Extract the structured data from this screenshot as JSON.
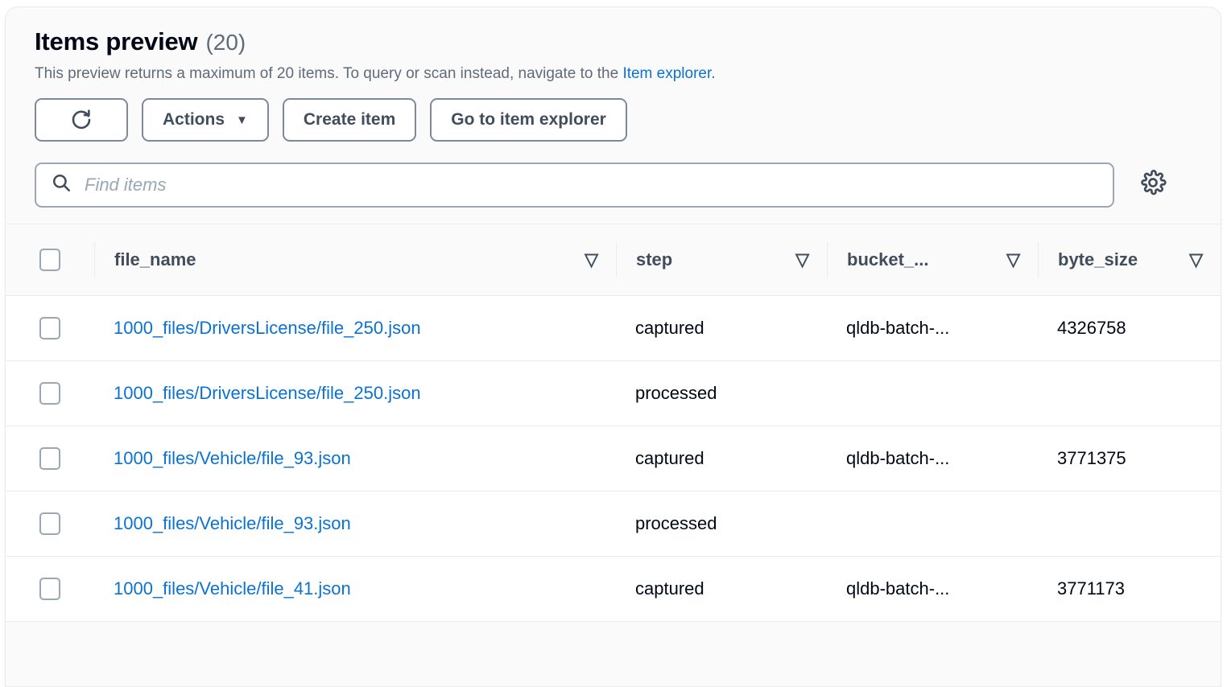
{
  "panel": {
    "title": "Items preview",
    "count": "(20)",
    "subtitle_before": "This preview returns a maximum of 20 items. To query or scan instead, navigate to the ",
    "subtitle_link": "Item explorer.",
    "icons": {
      "refresh": "refresh-icon",
      "settings": "gear-icon",
      "search": "search-icon",
      "sort": "sort-descending-icon"
    },
    "colors": {
      "link": "#0972d3",
      "text": "#000716",
      "muted": "#5f6b7a",
      "border": "#e9ebed",
      "button_border": "#7d8998",
      "background": "#fafafa",
      "row_background": "#ffffff"
    }
  },
  "toolbar": {
    "refresh_label": "",
    "actions_label": "Actions",
    "actions_caret": "▼",
    "create_item_label": "Create item",
    "go_to_item_explorer_label": "Go to item explorer"
  },
  "search": {
    "placeholder": "Find items",
    "value": ""
  },
  "table": {
    "columns": [
      {
        "key": "file_name",
        "label": "file_name"
      },
      {
        "key": "step",
        "label": "step"
      },
      {
        "key": "bucket",
        "label": "bucket_..."
      },
      {
        "key": "byte_size",
        "label": "byte_size"
      }
    ],
    "sort_glyph": "▽",
    "rows": [
      {
        "file_name": "1000_files/DriversLicense/file_250.json",
        "step": "captured",
        "bucket": "qldb-batch-...",
        "byte_size": "4326758"
      },
      {
        "file_name": "1000_files/DriversLicense/file_250.json",
        "step": "processed",
        "bucket": "",
        "byte_size": ""
      },
      {
        "file_name": "1000_files/Vehicle/file_93.json",
        "step": "captured",
        "bucket": "qldb-batch-...",
        "byte_size": "3771375"
      },
      {
        "file_name": "1000_files/Vehicle/file_93.json",
        "step": "processed",
        "bucket": "",
        "byte_size": ""
      },
      {
        "file_name": "1000_files/Vehicle/file_41.json",
        "step": "captured",
        "bucket": "qldb-batch-...",
        "byte_size": "3771173"
      }
    ]
  }
}
